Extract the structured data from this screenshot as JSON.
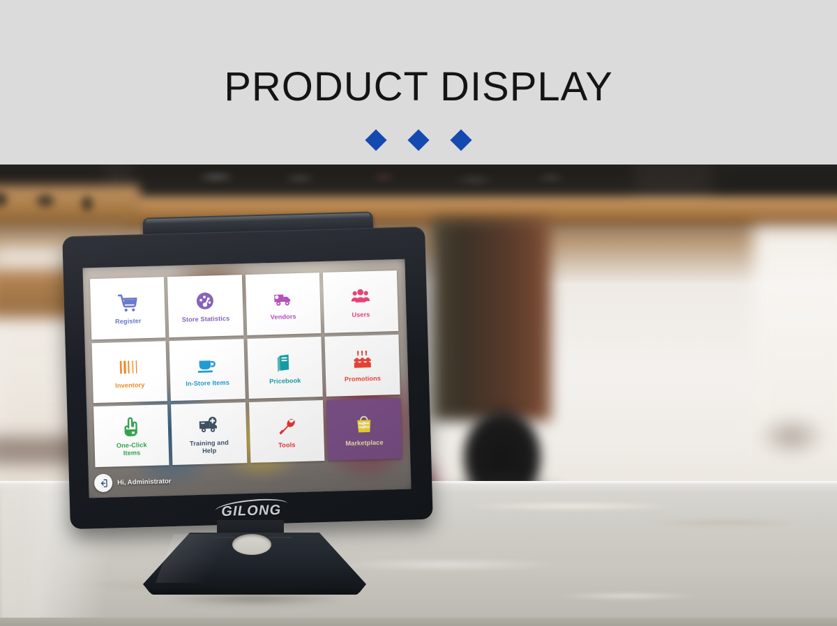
{
  "header": {
    "title": "PRODUCT DISPLAY",
    "separators": [
      "diamond",
      "diamond",
      "diamond"
    ],
    "background_color": "#dbdbdb",
    "diamond_color": "#1449b0",
    "title_color": "#141414"
  },
  "device": {
    "brand": "GILONG",
    "type": "touchscreen-pos-terminal",
    "bezel_color": "#1a1e24",
    "stand_color": "#232830"
  },
  "screen": {
    "tiles": [
      {
        "label": "Register",
        "icon": "shopping-cart-icon",
        "color": "#5566c4",
        "tile_bg": "#ffffff"
      },
      {
        "label": "Store Statistics",
        "icon": "gauge-icon",
        "color": "#7b57b5",
        "tile_bg": "#ffffff"
      },
      {
        "label": "Vendors",
        "icon": "delivery-truck-icon",
        "color": "#b24bb8",
        "tile_bg": "#ffffff"
      },
      {
        "label": "Users",
        "icon": "users-group-icon",
        "color": "#ef3d73",
        "tile_bg": "#ffffff"
      },
      {
        "label": "Inventory",
        "icon": "barcode-icon",
        "color": "#f0821e",
        "tile_bg": "#ffffff"
      },
      {
        "label": "In-Store Items",
        "icon": "coffee-cup-icon",
        "color": "#1b9ad6",
        "tile_bg": "#ffffff"
      },
      {
        "label": "Pricebook",
        "icon": "book-icon",
        "color": "#119ca6",
        "tile_bg": "#ffffff"
      },
      {
        "label": "Promotions",
        "icon": "birthday-cake-icon",
        "color": "#f04235",
        "tile_bg": "#ffffff"
      },
      {
        "label": "One-Click\nItems",
        "icon": "pointing-hand-icon",
        "color": "#2fa34a",
        "tile_bg": "#ffffff"
      },
      {
        "label": "Training and\nHelp",
        "icon": "ambulance-icon",
        "color": "#3d5163",
        "tile_bg": "#ffffff"
      },
      {
        "label": "Tools",
        "icon": "wrench-icon",
        "color": "#ef2f32",
        "tile_bg": "#ffffff"
      },
      {
        "label": "Marketplace",
        "icon": "shopping-bag-icon",
        "color": "#f2e3b0",
        "tile_bg": "#7b4f87"
      }
    ],
    "user_bar": {
      "greeting": "Hi, Administrator",
      "avatar_icon": "logout-arrow-icon"
    }
  }
}
